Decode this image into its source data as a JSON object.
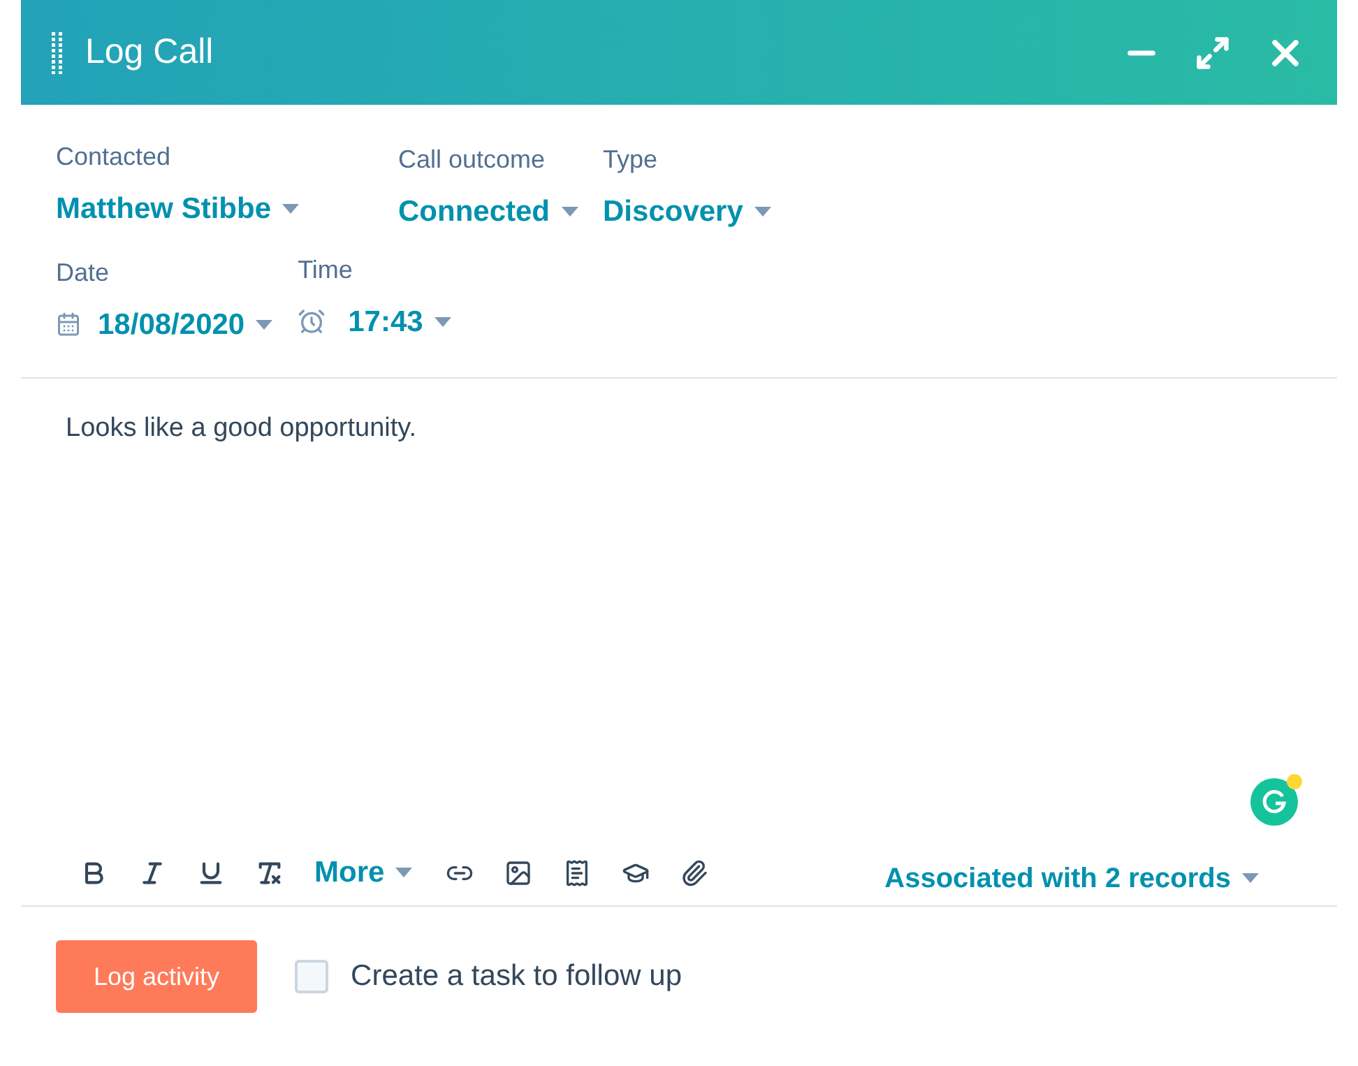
{
  "window": {
    "title": "Log Call"
  },
  "fields": [
    {
      "label": "Contacted",
      "value": "Matthew Stibbe",
      "kind": "plain"
    },
    {
      "label": "Call outcome",
      "value": "Connected",
      "kind": "plain"
    },
    {
      "label": "Type",
      "value": "Discovery",
      "kind": "plain"
    },
    {
      "label": "Date",
      "value": "18/08/2020",
      "kind": "date"
    },
    {
      "label": "Time",
      "value": "17:43",
      "kind": "time"
    }
  ],
  "note": {
    "value": "Looks like a good opportunity."
  },
  "toolbar": {
    "more": "More",
    "associated": "Associated with 2 records"
  },
  "footer": {
    "button": "Log activity",
    "checkbox": {
      "label": "Create a task to follow up",
      "checked": false
    }
  }
}
